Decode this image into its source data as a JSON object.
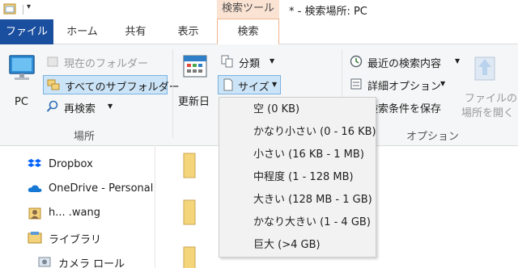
{
  "window": {
    "title": "* - 検索場所: PC",
    "contextual_header": "検索ツール"
  },
  "tabs": [
    {
      "label": "ファイル"
    },
    {
      "label": "ホーム"
    },
    {
      "label": "共有"
    },
    {
      "label": "表示"
    },
    {
      "label": "検索"
    }
  ],
  "ribbon": {
    "location": {
      "label": "場所",
      "pc": "PC",
      "current_folder": "現在のフォルダー",
      "all_subfolders": "すべてのサブフォルダー",
      "search_again": "再検索"
    },
    "refine": {
      "modified_date": "更新日",
      "kind": "分類",
      "size": "サイズ"
    },
    "options": {
      "label": "オプション",
      "recent_searches": "最近の検索内容",
      "advanced_options": "詳細オプション",
      "save_search": "検索条件を保存",
      "open_location_line1": "ファイルの",
      "open_location_line2": "場所を開く"
    }
  },
  "navigation": {
    "items": [
      {
        "label": "Dropbox"
      },
      {
        "label": "OneDrive - Personal"
      },
      {
        "label": "h... .wang"
      },
      {
        "label": "ライブラリ"
      },
      {
        "label": "カメラ ロール"
      }
    ]
  },
  "size_menu": {
    "items": [
      {
        "label": "空 (0 KB)"
      },
      {
        "label": "かなり小さい (0 - 16 KB)"
      },
      {
        "label": "小さい (16 KB - 1 MB)"
      },
      {
        "label": "中程度 (1 - 128 MB)"
      },
      {
        "label": "大きい (128 MB - 1 GB)"
      },
      {
        "label": "かなり大きい (1 - 4 GB)"
      },
      {
        "label": "巨大 (>4 GB)"
      }
    ]
  },
  "colors": {
    "file_tab": "#1a4fa0",
    "contextual_tab": "#fbe3d3",
    "selected_button": "#cce4f7",
    "selected_border": "#7ab3e0",
    "folder": "#f5d57a"
  },
  "icons": {
    "qat": [
      "quick-access-icon",
      "dropdown-arrow-icon"
    ],
    "ribbon": [
      "pc-icon",
      "folder-icon",
      "subfolders-icon",
      "search-again-icon",
      "calendar-icon",
      "kind-icon",
      "size-icon",
      "recent-search-icon",
      "options-icon",
      "open-location-icon"
    ],
    "nav": [
      "dropbox-icon",
      "onedrive-icon",
      "user-icon",
      "library-icon",
      "camera-roll-icon"
    ]
  }
}
